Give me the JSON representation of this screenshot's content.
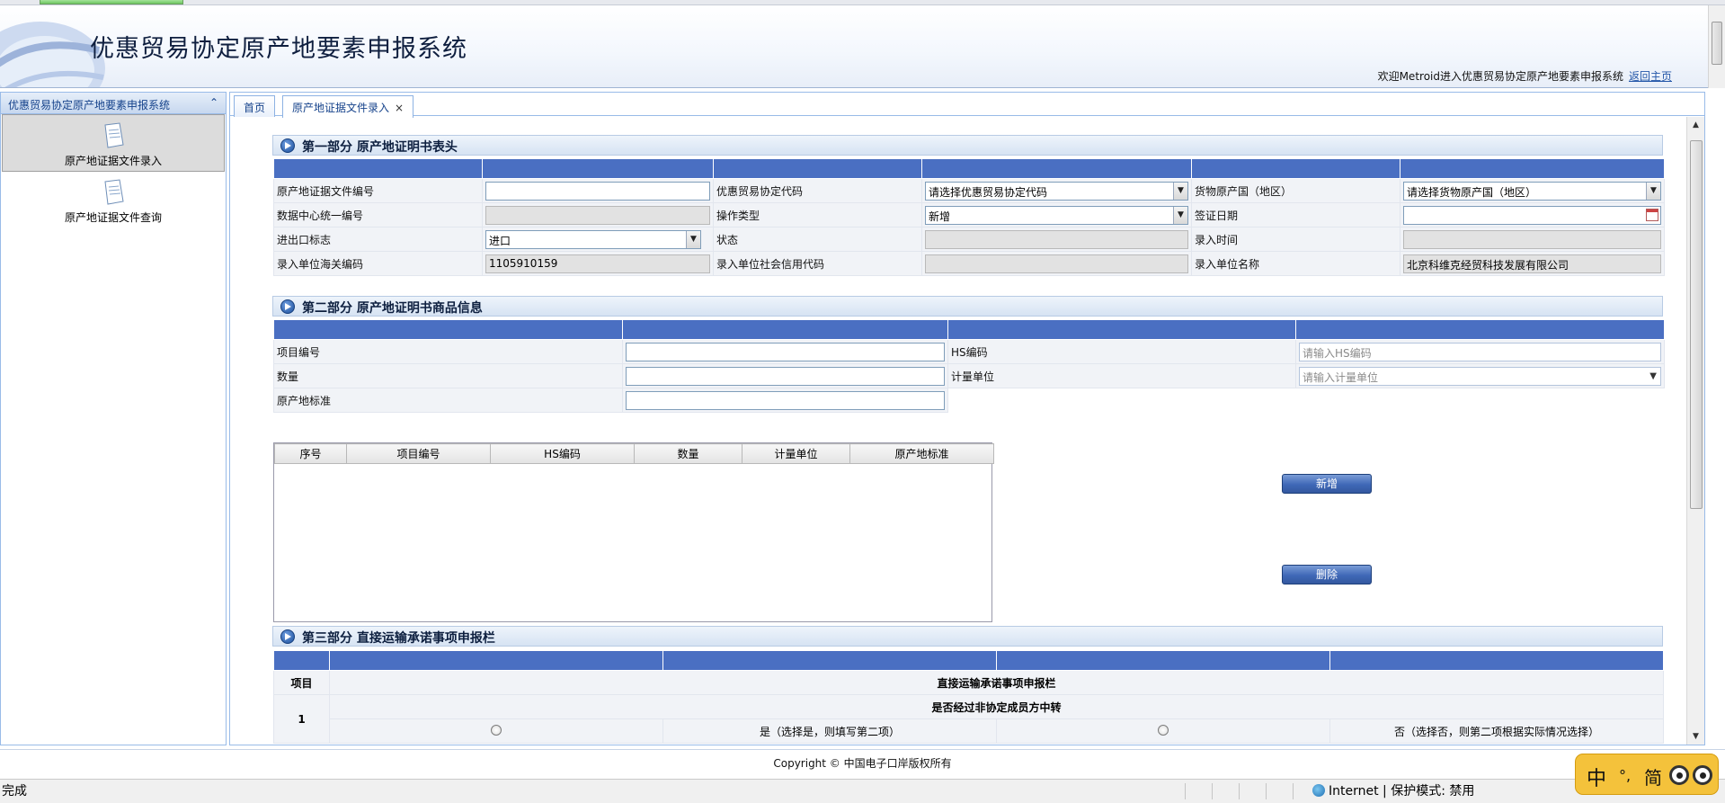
{
  "header": {
    "title": "优惠贸易协定原产地要素申报系统",
    "welcome": "欢迎Metroid进入优惠贸易协定原产地要素申报系统",
    "home_link": "返回主页"
  },
  "sidebar": {
    "title": "优惠贸易协定原产地要素申报系统",
    "items": [
      {
        "label": "原产地证据文件录入"
      },
      {
        "label": "原产地证据文件查询"
      }
    ]
  },
  "tabs": [
    {
      "label": "首页"
    },
    {
      "label": "原产地证据文件录入",
      "close": "×"
    }
  ],
  "part1": {
    "title": "第一部分 原产地证明书表头",
    "rows": [
      {
        "l1": "原产地证据文件编号",
        "v1": "",
        "l2": "优惠贸易协定代码",
        "v2": "请选择优惠贸易协定代码",
        "l3": "货物原产国（地区）",
        "v3": "请选择货物原产国（地区）"
      },
      {
        "l1": "数据中心统一编号",
        "v1": "",
        "l2": "操作类型",
        "v2": "新增",
        "l3": "签证日期",
        "v3": ""
      },
      {
        "l1": "进出口标志",
        "v1": "进口",
        "l2": "状态",
        "v2": "",
        "l3": "录入时间",
        "v3": ""
      },
      {
        "l1": "录入单位海关编码",
        "v1": "1105910159",
        "l2": "录入单位社会信用代码",
        "v2": "",
        "l3": "录入单位名称",
        "v3": "北京科维克经贸科技发展有限公司"
      }
    ]
  },
  "part2": {
    "title": "第二部分 原产地证明书商品信息",
    "item_no_label": "项目编号",
    "item_no_value": "",
    "hs_label": "HS编码",
    "hs_placeholder": "请输入HS编码",
    "qty_label": "数量",
    "qty_value": "",
    "unit_label": "计量单位",
    "unit_placeholder": "请输入计量单位",
    "origin_label": "原产地标准",
    "origin_value": "",
    "grid_columns": [
      "序号",
      "项目编号",
      "HS编码",
      "数量",
      "计量单位",
      "原产地标准"
    ],
    "add_button": "新增",
    "delete_button": "删除"
  },
  "part3": {
    "title": "第三部分 直接运输承诺事项申报栏",
    "col_item": "项目",
    "col_header": "直接运输承诺事项申报栏",
    "row_no": "1",
    "question": "是否经过非协定成员方中转",
    "yes_label": "是（选择是，则填写第二项）",
    "no_label": "否（选择否，则第二项根据实际情况选择）"
  },
  "footer": {
    "copyright": "Copyright © 中国电子口岸版权所有"
  },
  "statusbar": {
    "status": "完成",
    "zone": "Internet | 保护模式: 禁用"
  },
  "ime": {
    "lang": "中",
    "punct": "°,",
    "mode": "简"
  }
}
